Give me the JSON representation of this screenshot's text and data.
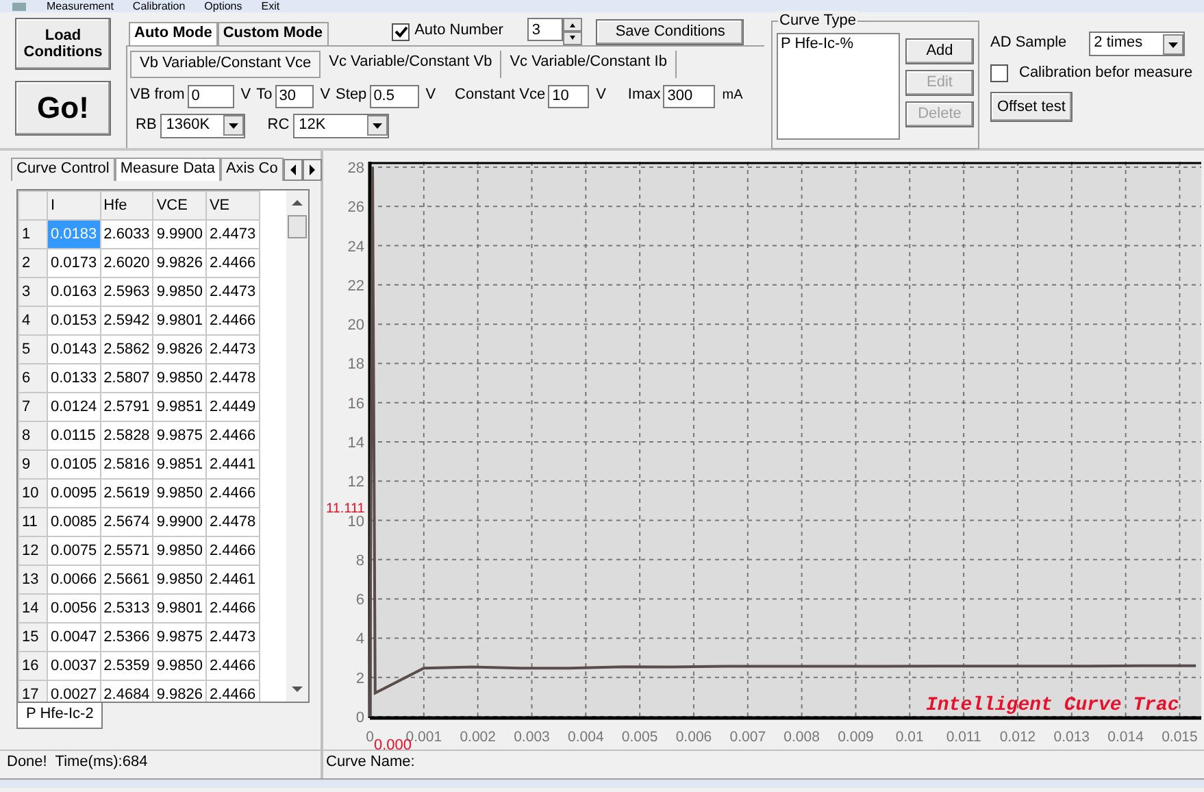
{
  "menu": [
    {
      "label": "Measurement"
    },
    {
      "label": "Calibration"
    },
    {
      "label": "Options"
    },
    {
      "label": "Exit"
    }
  ],
  "load_button": "Load Conditions",
  "go_button": "Go!",
  "mode_tabs": [
    {
      "label": "Auto Mode",
      "selected": true
    },
    {
      "label": "Custom Mode",
      "selected": false
    }
  ],
  "auto_number": {
    "label": "Auto Number",
    "checked": true,
    "value": "3"
  },
  "save_button": "Save Conditions",
  "sweep_tabs": [
    {
      "label": "Vb Variable/Constant Vce",
      "selected": true
    },
    {
      "label": "Vc Variable/Constant Vb",
      "selected": false
    },
    {
      "label": "Vc Variable/Constant Ib",
      "selected": false
    }
  ],
  "fields": [
    {
      "label": "VB from",
      "value": "0",
      "unit": "V"
    },
    {
      "label": "To",
      "value": "30",
      "unit": "V"
    },
    {
      "label": "Step",
      "value": "0.5",
      "unit": "V"
    },
    {
      "label": "Constant Vce",
      "value": "10",
      "unit": "V"
    },
    {
      "label": "Imax",
      "value": "300",
      "unit": "mA"
    }
  ],
  "resistors": [
    {
      "label": "RB",
      "value": "1360K"
    },
    {
      "label": "RC",
      "value": "12K"
    }
  ],
  "curve_type": {
    "title": "Curve Type",
    "items": [
      {
        "label": "P Hfe-Ic-%"
      }
    ],
    "buttons": [
      {
        "label": "Add",
        "disabled": false
      },
      {
        "label": "Edit",
        "disabled": true
      },
      {
        "label": "Delete",
        "disabled": true
      }
    ]
  },
  "ad_sample": {
    "label": "AD Sample",
    "value": "2 times"
  },
  "calibration": {
    "label": "Calibration befor measure",
    "checked": false
  },
  "offset_button": "Offset test",
  "left_tabs": [
    {
      "label": "Curve Control",
      "selected": false
    },
    {
      "label": "Measure Data",
      "selected": true
    },
    {
      "label": "Axis Co",
      "selected": false
    }
  ],
  "table": {
    "columns": [
      "",
      "I",
      "Hfe",
      "VCE",
      "VE"
    ],
    "rows": [
      {
        "cells": [
          "1",
          "0.0183",
          "2.6033",
          "9.9900",
          "2.4473"
        ],
        "selected": true
      },
      {
        "cells": [
          "2",
          "0.0173",
          "2.6020",
          "9.9826",
          "2.4466"
        ],
        "selected": false
      },
      {
        "cells": [
          "3",
          "0.0163",
          "2.5963",
          "9.9850",
          "2.4473"
        ],
        "selected": false
      },
      {
        "cells": [
          "4",
          "0.0153",
          "2.5942",
          "9.9801",
          "2.4466"
        ],
        "selected": false
      },
      {
        "cells": [
          "5",
          "0.0143",
          "2.5862",
          "9.9826",
          "2.4473"
        ],
        "selected": false
      },
      {
        "cells": [
          "6",
          "0.0133",
          "2.5807",
          "9.9850",
          "2.4478"
        ],
        "selected": false
      },
      {
        "cells": [
          "7",
          "0.0124",
          "2.5791",
          "9.9851",
          "2.4449"
        ],
        "selected": false
      },
      {
        "cells": [
          "8",
          "0.0115",
          "2.5828",
          "9.9875",
          "2.4466"
        ],
        "selected": false
      },
      {
        "cells": [
          "9",
          "0.0105",
          "2.5816",
          "9.9851",
          "2.4441"
        ],
        "selected": false
      },
      {
        "cells": [
          "10",
          "0.0095",
          "2.5619",
          "9.9850",
          "2.4466"
        ],
        "selected": false
      },
      {
        "cells": [
          "11",
          "0.0085",
          "2.5674",
          "9.9900",
          "2.4478"
        ],
        "selected": false
      },
      {
        "cells": [
          "12",
          "0.0075",
          "2.5571",
          "9.9850",
          "2.4466"
        ],
        "selected": false
      },
      {
        "cells": [
          "13",
          "0.0066",
          "2.5661",
          "9.9850",
          "2.4461"
        ],
        "selected": false
      },
      {
        "cells": [
          "14",
          "0.0056",
          "2.5313",
          "9.9801",
          "2.4466"
        ],
        "selected": false
      },
      {
        "cells": [
          "15",
          "0.0047",
          "2.5366",
          "9.9875",
          "2.4473"
        ],
        "selected": false
      },
      {
        "cells": [
          "16",
          "0.0037",
          "2.5359",
          "9.9850",
          "2.4466"
        ],
        "selected": false
      },
      {
        "cells": [
          "17",
          "0.0027",
          "2.4684",
          "9.9826",
          "2.4466"
        ],
        "selected": false
      }
    ]
  },
  "bottom_tabs": [
    {
      "label": "P Hfe-Ic-2",
      "selected": true
    }
  ],
  "chart": {
    "chart_data": {
      "type": "line",
      "x": [
        0,
        5e-05,
        0.0001,
        0.001,
        0.0019,
        0.0028,
        0.0037,
        0.0047,
        0.0056,
        0.0066,
        0.0075,
        0.0085,
        0.0095,
        0.0105,
        0.0115,
        0.0124,
        0.0133,
        0.0143,
        0.0153
      ],
      "grid": true,
      "series": [
        {
          "color": "#5a4c4a",
          "values": [
            0,
            28,
            1.2,
            2.47,
            2.53,
            2.47,
            2.47,
            2.54,
            2.53,
            2.57,
            2.56,
            2.57,
            2.56,
            2.58,
            2.58,
            2.58,
            2.58,
            2.59,
            2.59
          ]
        }
      ],
      "xlim": [
        0,
        0.0154
      ],
      "ylim": [
        0,
        28
      ],
      "xticks": [
        {
          "value": 0,
          "label": "0"
        },
        {
          "value": 0.001,
          "label": "0.001"
        },
        {
          "value": 0.002,
          "label": "0.002"
        },
        {
          "value": 0.003,
          "label": "0.003"
        },
        {
          "value": 0.004,
          "label": "0.004"
        },
        {
          "value": 0.005,
          "label": "0.005"
        },
        {
          "value": 0.006,
          "label": "0.006"
        },
        {
          "value": 0.007,
          "label": "0.007"
        },
        {
          "value": 0.008,
          "label": "0.008"
        },
        {
          "value": 0.009,
          "label": "0.009"
        },
        {
          "value": 0.01,
          "label": "0.01"
        },
        {
          "value": 0.011,
          "label": "0.011"
        },
        {
          "value": 0.012,
          "label": "0.012"
        },
        {
          "value": 0.013,
          "label": "0.013"
        },
        {
          "value": 0.014,
          "label": "0.014"
        },
        {
          "value": 0.015,
          "label": "0.015"
        }
      ],
      "yticks": [
        0,
        2,
        4,
        6,
        8,
        10,
        12,
        14,
        16,
        18,
        20,
        22,
        24,
        26,
        28
      ],
      "annotations": [
        {
          "text": "11.111"
        },
        {
          "text": "0.000"
        },
        {
          "text": "Intelligent Curve Trac"
        }
      ]
    }
  },
  "status_bar": {
    "message": "Done!  Time(ms):684",
    "curve_name": "Curve Name:"
  }
}
